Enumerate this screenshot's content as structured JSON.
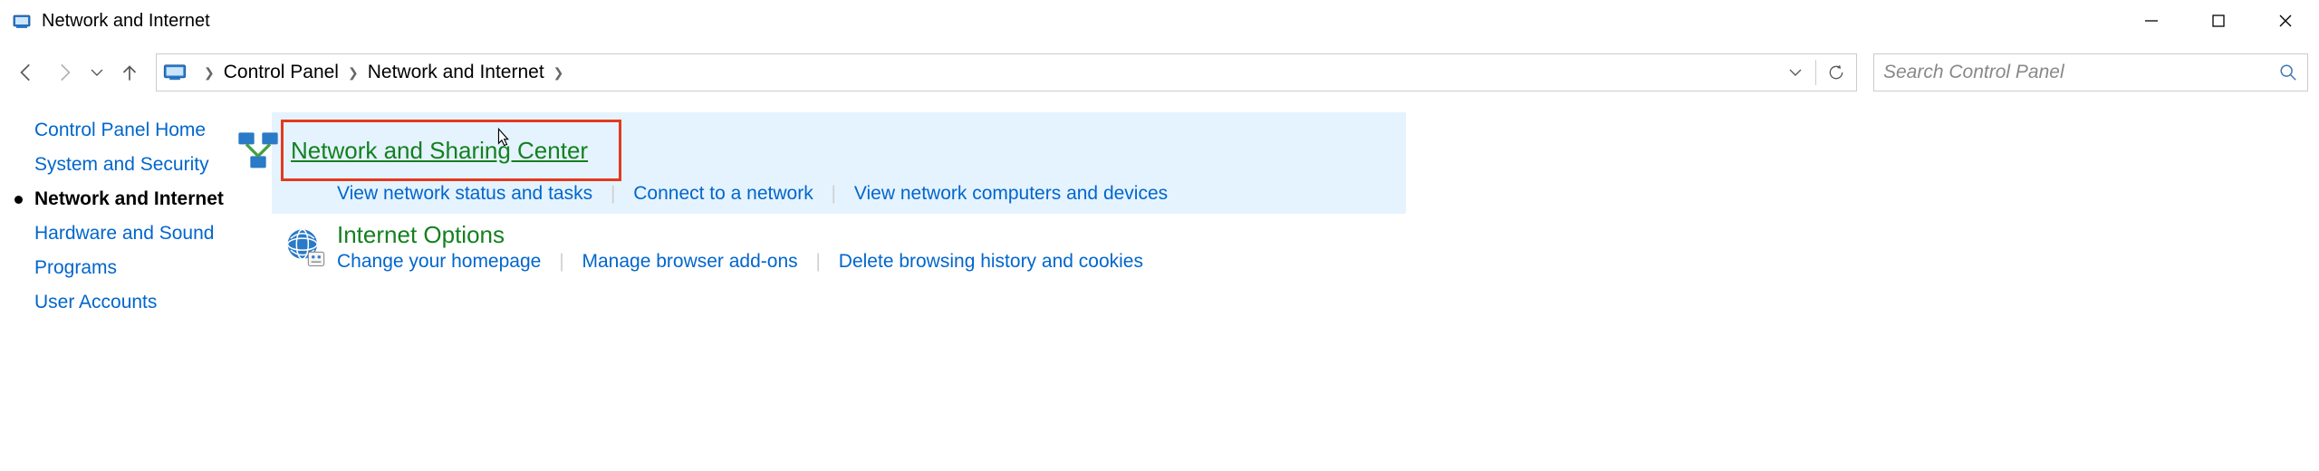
{
  "window": {
    "title": "Network and Internet"
  },
  "breadcrumb": {
    "items": [
      "Control Panel",
      "Network and Internet"
    ]
  },
  "search": {
    "placeholder": "Search Control Panel"
  },
  "sidebar": {
    "items": [
      {
        "label": "Control Panel Home",
        "selected": false
      },
      {
        "label": "System and Security",
        "selected": false
      },
      {
        "label": "Network and Internet",
        "selected": true
      },
      {
        "label": "Hardware and Sound",
        "selected": false
      },
      {
        "label": "Programs",
        "selected": false
      },
      {
        "label": "User Accounts",
        "selected": false
      }
    ]
  },
  "categories": [
    {
      "title": "Network and Sharing Center",
      "highlighted": true,
      "boxed": true,
      "tasks": [
        "View network status and tasks",
        "Connect to a network",
        "View network computers and devices"
      ]
    },
    {
      "title": "Internet Options",
      "highlighted": false,
      "boxed": false,
      "tasks": [
        "Change your homepage",
        "Manage browser add-ons",
        "Delete browsing history and cookies"
      ]
    }
  ]
}
